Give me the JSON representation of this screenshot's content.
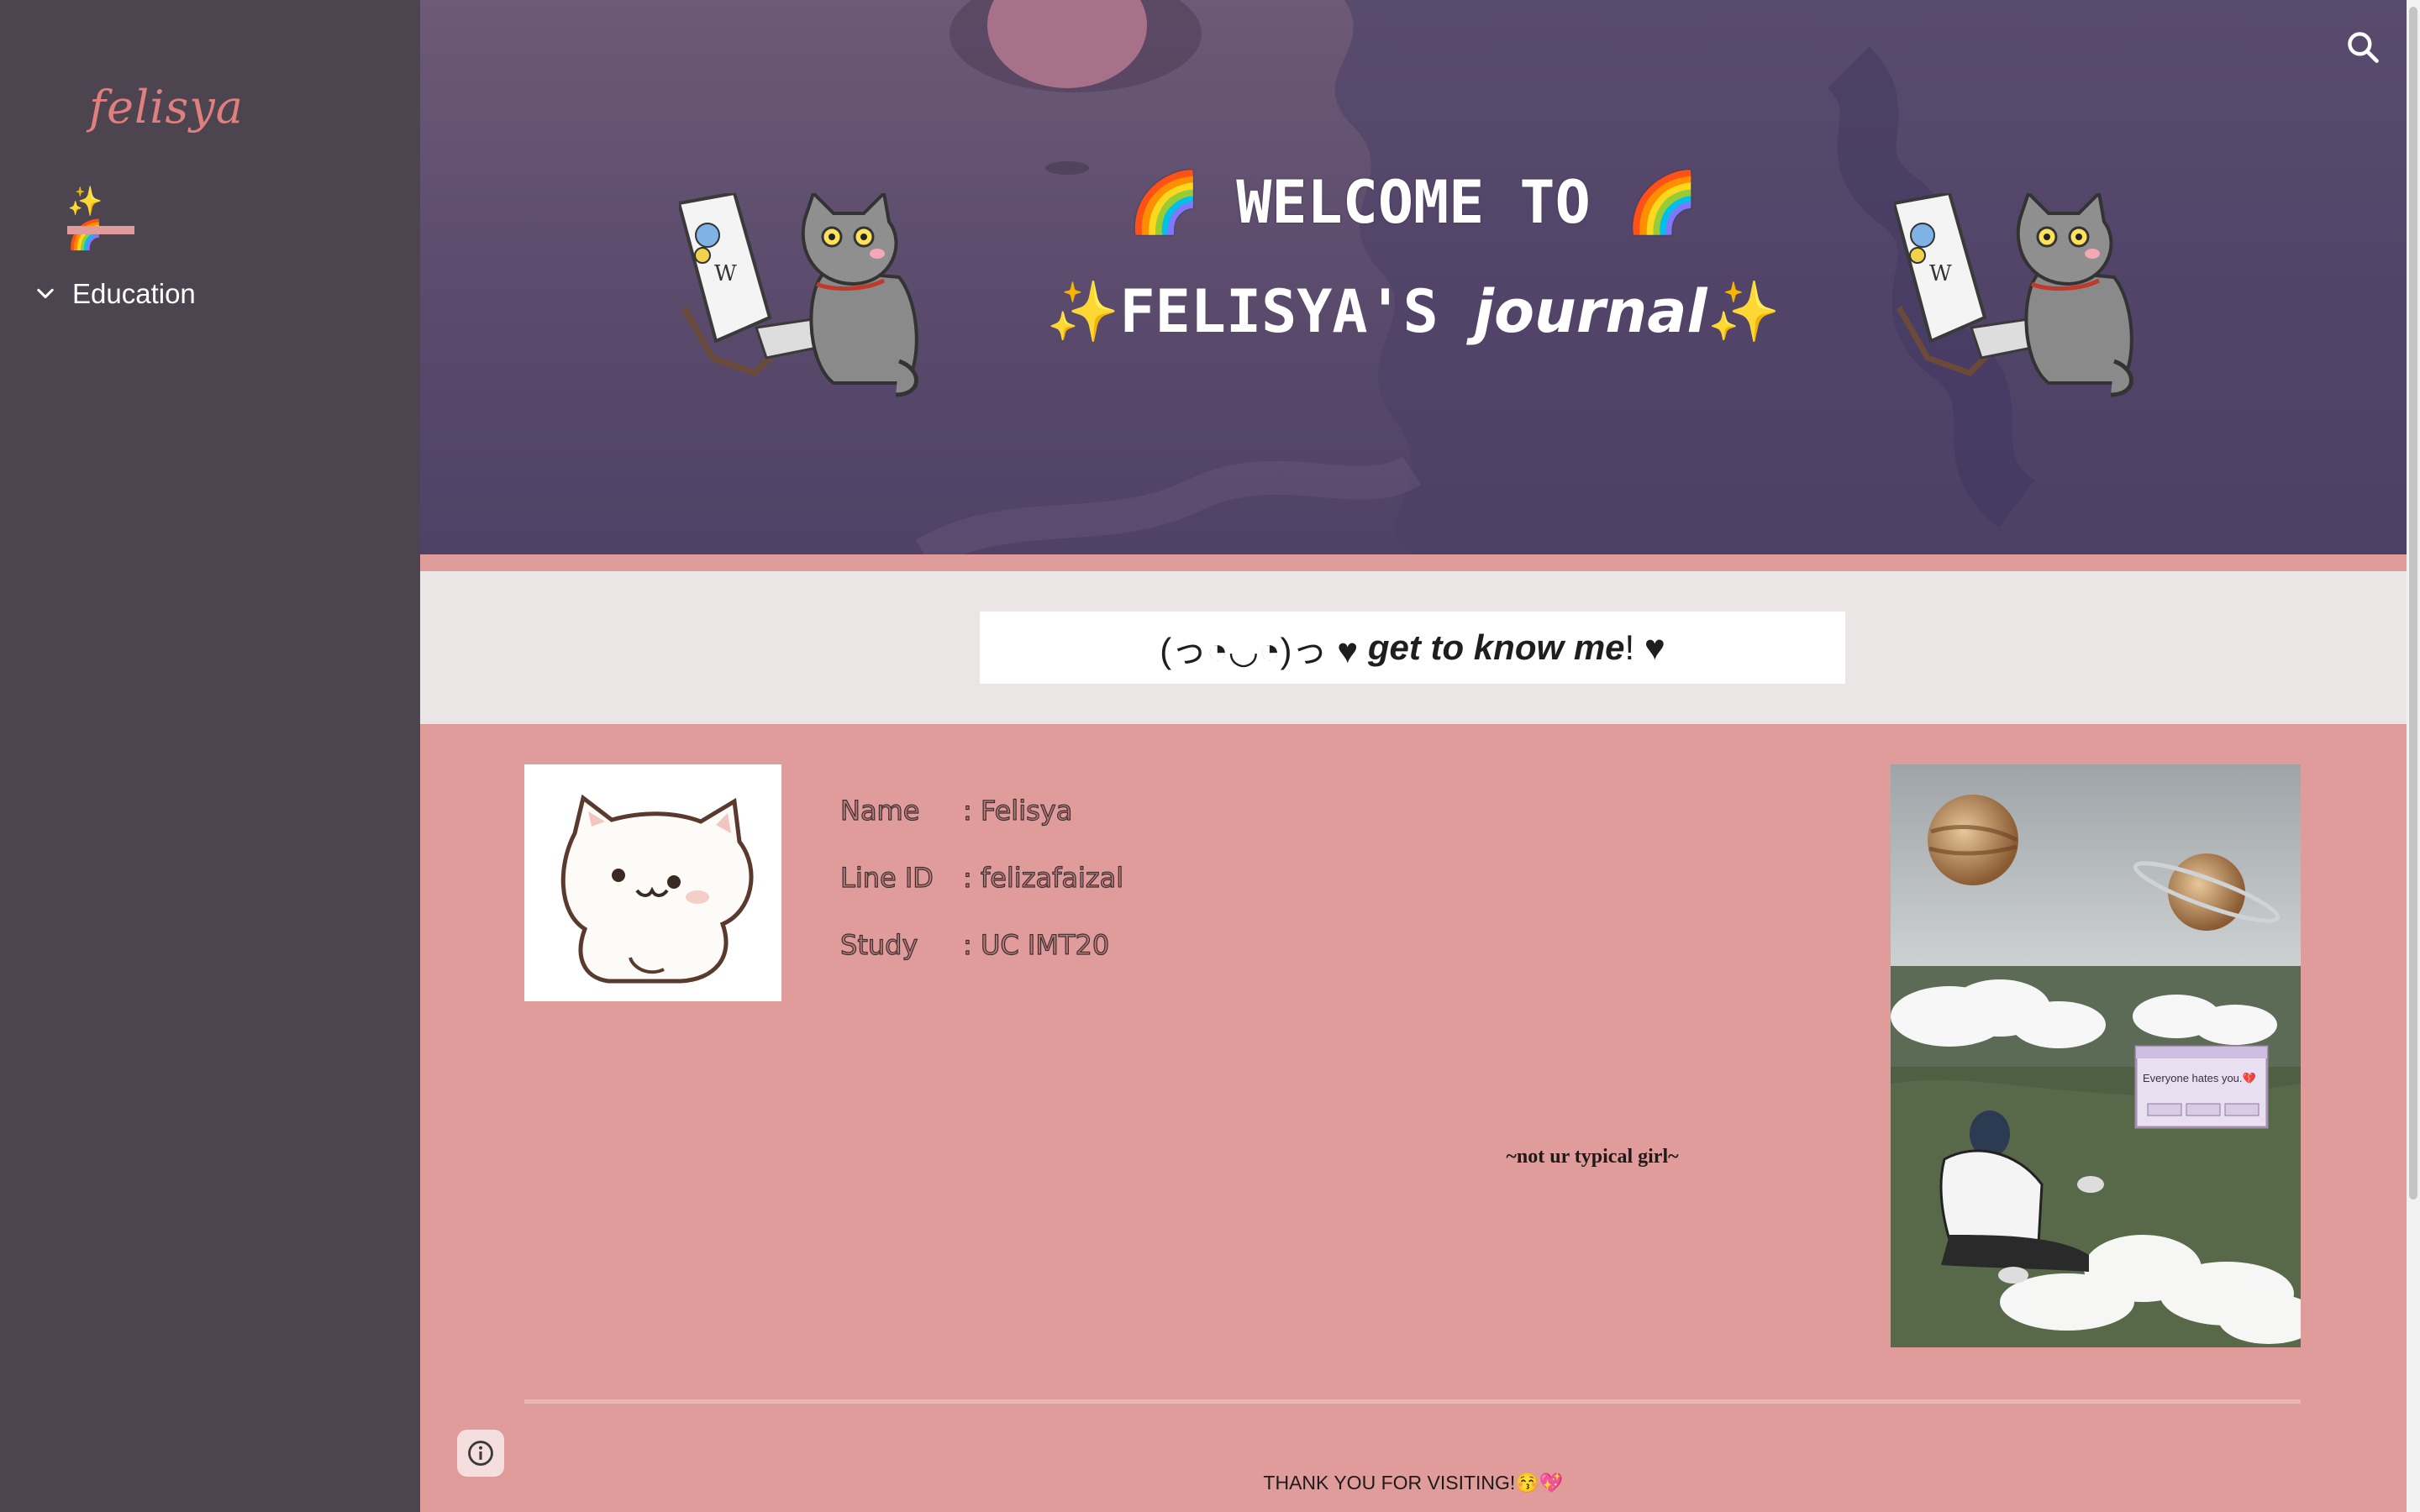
{
  "sidebar": {
    "site_title": "felisya",
    "items": [
      {
        "label": "✨🌈",
        "active": true
      },
      {
        "label": "Education",
        "expandable": true
      }
    ]
  },
  "header": {
    "title_line1": "🌈 WELCOME TO 🌈",
    "title_line2_prefix": "✨FELISYA'S ",
    "title_line2_italic": "journal",
    "title_line2_suffix": "✨",
    "search_icon": "search-icon"
  },
  "tagline": {
    "prefix": "(っ◔◡◔)っ ♥ ",
    "italic": "get to know me",
    "suffix": " ! ♥"
  },
  "profile": {
    "rows": [
      {
        "label": "Name",
        "value": ": Felisya"
      },
      {
        "label": "Line ID",
        "value": ": felizafaizal"
      },
      {
        "label": "Study",
        "value": ": UC IMT20"
      }
    ],
    "motto": "~not ur typical girl~",
    "photo_popup_text": "Everyone hates you.💔"
  },
  "footer": {
    "text": "THANK YOU FOR VISITING!😚💖",
    "info_icon": "info-icon"
  },
  "colors": {
    "sidebar_bg": "#4c444e",
    "accent_pink": "#e09c9b",
    "logo_pink": "#df7f7e",
    "band_grey": "#eae6e6"
  }
}
